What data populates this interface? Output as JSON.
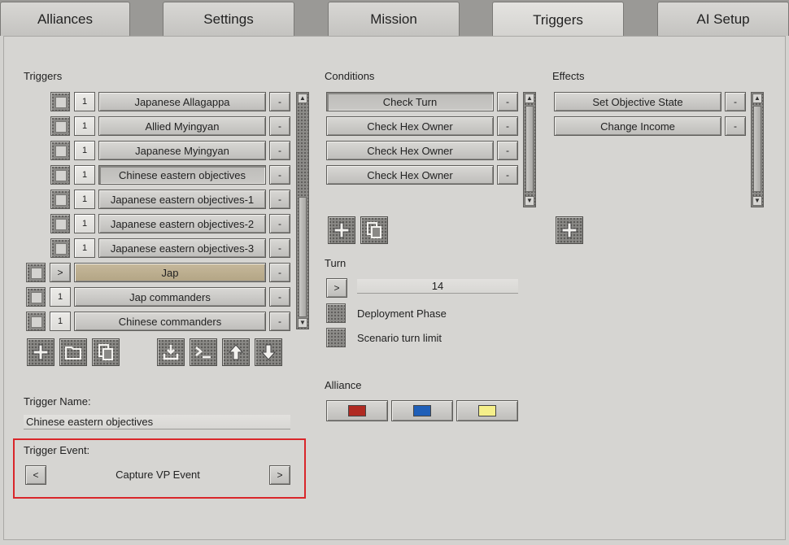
{
  "tabs": [
    {
      "label": "Alliances",
      "active": false
    },
    {
      "label": "Settings",
      "active": false
    },
    {
      "label": "Mission",
      "active": false
    },
    {
      "label": "Triggers",
      "active": true
    },
    {
      "label": "AI Setup",
      "active": false
    }
  ],
  "triggers": {
    "heading": "Triggers",
    "remove_label": "-",
    "items": [
      {
        "count": "1",
        "name": "Japanese Allagappa"
      },
      {
        "count": "1",
        "name": "Allied Myingyan"
      },
      {
        "count": "1",
        "name": "Japanese Myingyan"
      },
      {
        "count": "1",
        "name": "Chinese eastern objectives"
      },
      {
        "count": "1",
        "name": "Japanese eastern objectives-1"
      },
      {
        "count": "1",
        "name": "Japanese eastern objectives-2"
      },
      {
        "count": "1",
        "name": "Japanese eastern objectives-3"
      },
      {
        "count": ">",
        "name": "Jap"
      },
      {
        "count": "1",
        "name": "Jap commanders"
      },
      {
        "count": "1",
        "name": "Chinese commanders"
      }
    ],
    "toolbar_icons": [
      "add-icon",
      "folder-icon",
      "copy-icon",
      "import-icon",
      "console-icon",
      "move-up-icon",
      "move-down-icon"
    ]
  },
  "trigger_name": {
    "label": "Trigger Name:",
    "value": "Chinese eastern objectives"
  },
  "trigger_event": {
    "label": "Trigger Event:",
    "value": "Capture VP Event",
    "prev": "<",
    "next": ">"
  },
  "conditions": {
    "heading": "Conditions",
    "items": [
      "Check Turn",
      "Check Hex Owner",
      "Check Hex Owner",
      "Check Hex Owner"
    ],
    "remove_label": "-"
  },
  "turn": {
    "heading": "Turn",
    "operator": ">",
    "value": "14",
    "options": [
      "Deployment Phase",
      "Scenario turn limit"
    ]
  },
  "alliance": {
    "heading": "Alliance",
    "colors": [
      "#b02a22",
      "#1f5fb8",
      "#f5ef8a"
    ]
  },
  "effects": {
    "heading": "Effects",
    "items": [
      "Set Objective State",
      "Change Income"
    ],
    "remove_label": "-"
  }
}
